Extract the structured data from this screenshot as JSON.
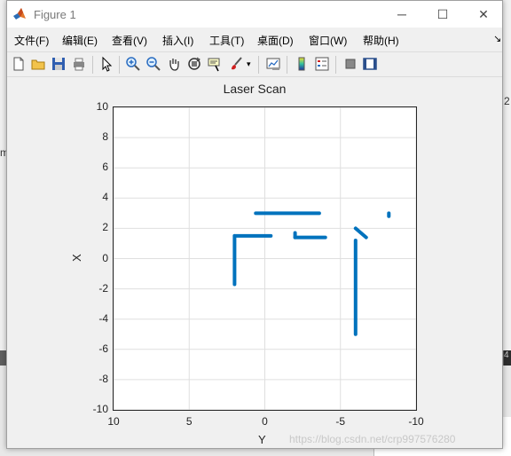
{
  "window": {
    "title": "Figure 1",
    "controls": {
      "minimize": "─",
      "maximize": "☐",
      "close": "✕"
    }
  },
  "menubar": {
    "items": [
      "文件(F)",
      "编辑(E)",
      "查看(V)",
      "插入(I)",
      "工具(T)",
      "桌面(D)",
      "窗口(W)",
      "帮助(H)"
    ],
    "overflow_icon": "arrow-icon"
  },
  "toolbar": {
    "buttons": [
      "new-figure-icon",
      "open-icon",
      "save-icon",
      "print-icon",
      "edit-plot-icon",
      "zoom-in-icon",
      "zoom-out-icon",
      "pan-icon",
      "rotate-icon",
      "data-cursor-icon",
      "brush-icon",
      "link-icon",
      "colorbar-icon",
      "legend-icon",
      "hide-plot-tools-icon",
      "show-plot-tools-icon"
    ]
  },
  "background": {
    "left_fragment": "m",
    "right_fragment": "2",
    "strip_fragment": "4"
  },
  "watermark": "https://blog.csdn.net/crp997576280",
  "chart_data": {
    "type": "scatter",
    "title": "Laser Scan",
    "xlabel": "Y",
    "ylabel": "X",
    "xlim": [
      10,
      -10
    ],
    "ylim": [
      -10,
      10
    ],
    "x_reversed": true,
    "xticks": [
      10,
      5,
      0,
      -5,
      -10
    ],
    "yticks": [
      10,
      8,
      6,
      4,
      2,
      0,
      -2,
      -4,
      -6,
      -8,
      -10
    ],
    "grid": true,
    "marker_color": "#0072bd",
    "segments": [
      {
        "y0": 2.0,
        "x0": -1.7,
        "y1": 2.0,
        "x1": 1.5
      },
      {
        "y0": 2.0,
        "x0": 1.5,
        "y1": -0.4,
        "x1": 1.5
      },
      {
        "y0": 0.6,
        "x0": 3.0,
        "y1": -3.6,
        "x1": 3.0
      },
      {
        "y0": -2.0,
        "x0": 1.4,
        "y1": -4.0,
        "x1": 1.4
      },
      {
        "y0": -2.0,
        "x0": 1.4,
        "y1": -2.0,
        "x1": 1.7
      },
      {
        "y0": -6.0,
        "x0": 1.2,
        "y1": -6.0,
        "x1": -5.0
      },
      {
        "y0": -6.0,
        "x0": 2.0,
        "y1": -6.7,
        "x1": 1.4
      },
      {
        "y0": -8.2,
        "x0": 3.0,
        "y1": -8.2,
        "x1": 2.8
      }
    ]
  }
}
